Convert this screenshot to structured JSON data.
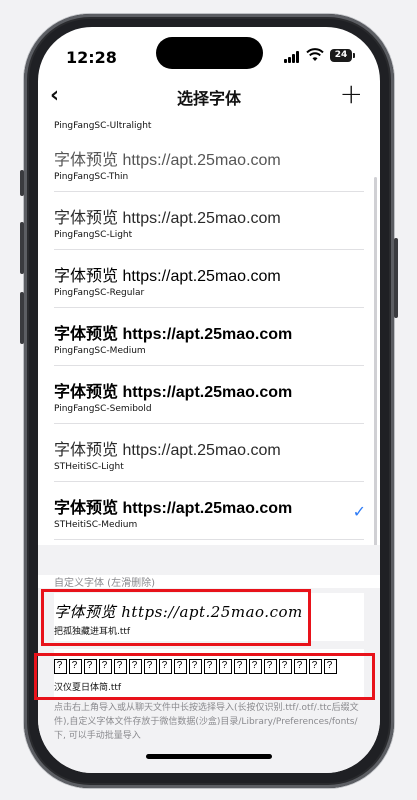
{
  "status_bar": {
    "time": "12:28",
    "battery": "24"
  },
  "nav": {
    "back_icon": "chevron-left-icon",
    "title": "选择字体",
    "add_icon": "plus-icon"
  },
  "fonts": [
    {
      "preview": "",
      "name": "PingFangSC-Ultralight",
      "weight": 200,
      "selected": false
    },
    {
      "preview": "字体预览 https://apt.25mao.com",
      "name": "PingFangSC-Thin",
      "weight": 100,
      "selected": false
    },
    {
      "preview": "字体预览 https://apt.25mao.com",
      "name": "PingFangSC-Light",
      "weight": 300,
      "selected": false
    },
    {
      "preview": "字体预览 https://apt.25mao.com",
      "name": "PingFangSC-Regular",
      "weight": 400,
      "selected": false
    },
    {
      "preview": "字体预览 https://apt.25mao.com",
      "name": "PingFangSC-Medium",
      "weight": 700,
      "selected": false
    },
    {
      "preview": "字体预览 https://apt.25mao.com",
      "name": "PingFangSC-Semibold",
      "weight": 700,
      "selected": false
    },
    {
      "preview": "字体预览 https://apt.25mao.com",
      "name": "STHeitiSC-Light",
      "weight": 300,
      "selected": false
    },
    {
      "preview": "字体预览 https://apt.25mao.com",
      "name": "STHeitiSC-Medium",
      "weight": 700,
      "selected": true
    }
  ],
  "custom_section": {
    "header": "自定义字体 (左滑删除)",
    "items": [
      {
        "preview": "字体预览 https://apt.25mao.com",
        "name": "把孤独藏进耳机.ttf",
        "style": "handwritten"
      },
      {
        "preview": "",
        "name": "汉仪夏日体简.ttf",
        "style": "tofu",
        "tofu_count": 19
      }
    ],
    "note": "点击右上角导入或从聊天文件中长按选择导入(长按仅识别.ttf/.otf/.ttc后缀文件),自定义字体文件存放于微信数据(沙盒)目录/Library/Preferences/fonts/下, 可以手动批量导入"
  },
  "colors": {
    "accent": "#2f7cf6",
    "highlight": "#e8121a"
  }
}
